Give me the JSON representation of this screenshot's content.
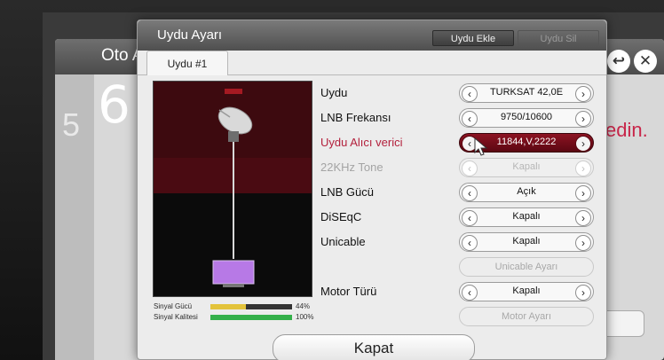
{
  "background_window": {
    "title": "Oto Ay",
    "step_faded": "5",
    "step_current": "6",
    "body_text": "edin."
  },
  "dialog": {
    "title": "Uydu Ayarı",
    "header_buttons": [
      {
        "label": "Uydu Ekle"
      },
      {
        "label": "Uydu Sil"
      }
    ],
    "tab": "Uydu #1",
    "preview": {
      "signal_power_label": "Sinyal Gücü",
      "signal_power_value": "44%",
      "signal_power_fraction": 0.44,
      "signal_quality_label": "Sinyal Kalitesi",
      "signal_quality_value": "100%",
      "signal_quality_fraction": 1.0
    },
    "rows": [
      {
        "label": "Uydu",
        "value": "TURKSAT 42,0E"
      },
      {
        "label": "LNB Frekansı",
        "value": "9750/10600"
      },
      {
        "label": "Uydu Alıcı verici",
        "value": "11844,V,2222"
      },
      {
        "label": "22KHz Tone",
        "value": "Kapalı"
      },
      {
        "label": "LNB Gücü",
        "value": "Açık"
      },
      {
        "label": "DiSEqC",
        "value": "Kapalı"
      },
      {
        "label": "Unicable",
        "value": "Kapalı"
      },
      {
        "label": "Motor Türü",
        "value": "Kapalı"
      }
    ],
    "unicable_button": "Unicable Ayarı",
    "motor_button": "Motor Ayarı",
    "close_button": "Kapat"
  },
  "colors": {
    "accent_red": "#8c1322",
    "active_label_red": "#b3203c",
    "signal_power_yellow": "#e3c33a",
    "signal_quality_green": "#34b04a"
  }
}
